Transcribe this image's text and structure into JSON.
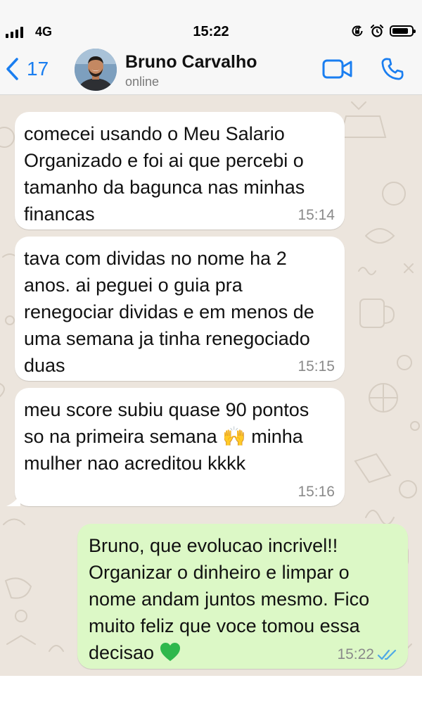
{
  "status_bar": {
    "network": "4G",
    "time": "15:22"
  },
  "header": {
    "back_count": "17",
    "contact_name": "Bruno Carvalho",
    "contact_status": "online"
  },
  "colors": {
    "accent": "#1a7ef0",
    "incoming_bubble": "#ffffff",
    "outgoing_bubble": "#dcf8c6",
    "chat_background": "#ece5dd",
    "read_ticks": "#4fa9e6",
    "heart": "#2eb84c"
  },
  "messages": [
    {
      "direction": "incoming",
      "text": "comecei usando o Meu Salario Organizado e foi ai que percebi o tamanho da bagunca nas minhas financas",
      "time": "15:14"
    },
    {
      "direction": "incoming",
      "text": "tava com dividas no nome ha 2 anos. ai peguei o guia pra renegociar dividas e em menos de uma semana ja tinha renegociado duas",
      "time": "15:15"
    },
    {
      "direction": "incoming",
      "text_before_emoji": "meu score subiu quase 90 pontos so na primeira semana",
      "emoji": "🙌",
      "text_after_emoji": " minha mulher nao acreditou kkkk",
      "time": "15:16"
    },
    {
      "direction": "outgoing",
      "text": "Bruno, que evolucao incrivel!! Organizar o dinheiro e limpar o nome andam juntos mesmo. Fico muito feliz que voce tomou essa decisao",
      "time": "15:22",
      "status": "read"
    }
  ],
  "icons": {
    "back": "chevron-left-icon",
    "video": "video-camera-icon",
    "call": "phone-icon",
    "read_receipt": "double-check-icon",
    "heart": "green-heart-emoji"
  }
}
